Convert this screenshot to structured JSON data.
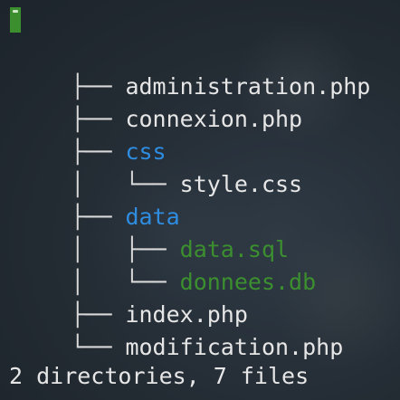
{
  "terminal": {
    "tree_lines": [
      {
        "prefix": "├──",
        "name": "administration.php",
        "type": "file"
      },
      {
        "prefix": "├──",
        "name": "connexion.php",
        "type": "file"
      },
      {
        "prefix": "├──",
        "name": "css",
        "type": "directory"
      },
      {
        "prefix": "│   └──",
        "name": "style.css",
        "type": "file"
      },
      {
        "prefix": "├──",
        "name": "data",
        "type": "directory"
      },
      {
        "prefix": "│   ├──",
        "name": "data.sql",
        "type": "database"
      },
      {
        "prefix": "│   └──",
        "name": "donnees.db",
        "type": "database"
      },
      {
        "prefix": "├──",
        "name": "index.php",
        "type": "file"
      },
      {
        "prefix": "└──",
        "name": "modification.php",
        "type": "file"
      }
    ],
    "summary": "2 directories, 7 files"
  },
  "colors": {
    "background": "#232b33",
    "directory": "#2e8de0",
    "database": "#3c8f2f",
    "file": "#e6e6e6",
    "cursor": "#3c8f2f"
  }
}
